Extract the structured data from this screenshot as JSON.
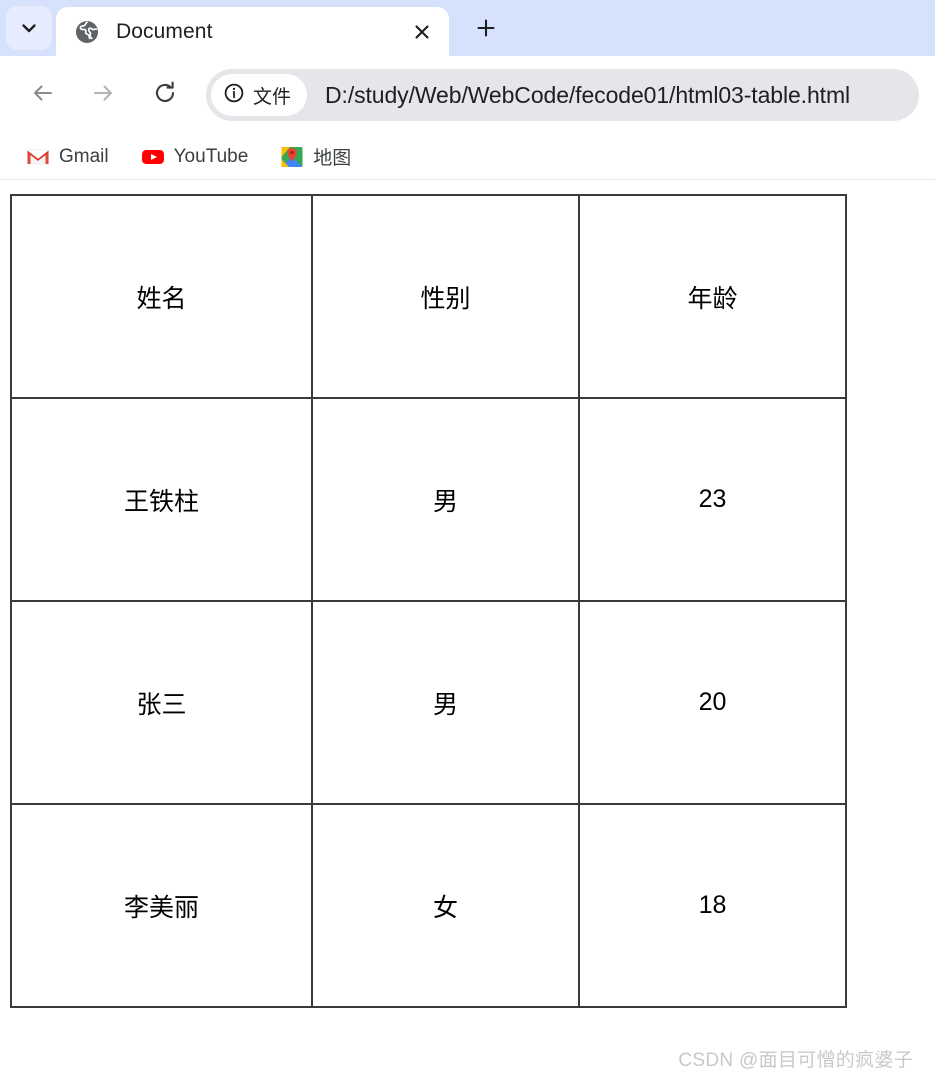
{
  "browser": {
    "tab_search_icon": "chevron-down-icon",
    "tab": {
      "favicon": "globe-icon",
      "title": "Document",
      "close_icon": "close-icon"
    },
    "new_tab_icon": "plus-icon",
    "toolbar": {
      "back_icon": "arrow-left-icon",
      "forward_icon": "arrow-right-icon",
      "reload_icon": "reload-icon",
      "origin_chip": {
        "info_icon": "info-circle-icon",
        "label": "文件"
      },
      "url": "D:/study/Web/WebCode/fecode01/html03-table.html"
    },
    "bookmarks": [
      {
        "icon": "gmail-icon",
        "label": "Gmail"
      },
      {
        "icon": "youtube-icon",
        "label": "YouTube"
      },
      {
        "icon": "google-maps-icon",
        "label": "地图"
      }
    ]
  },
  "page": {
    "table": {
      "rows": [
        [
          "姓名",
          "性别",
          "年龄"
        ],
        [
          "王铁柱",
          "男",
          "23"
        ],
        [
          "张三",
          "男",
          "20"
        ],
        [
          "李美丽",
          "女",
          "18"
        ]
      ]
    },
    "watermark": "CSDN @面目可憎的疯婆子"
  },
  "colors": {
    "tabstrip_bg": "#d6e2fb",
    "omnibox_bg": "#e5e5ea",
    "table_border": "#3a3a3a",
    "watermark": "#c9c9c9"
  }
}
